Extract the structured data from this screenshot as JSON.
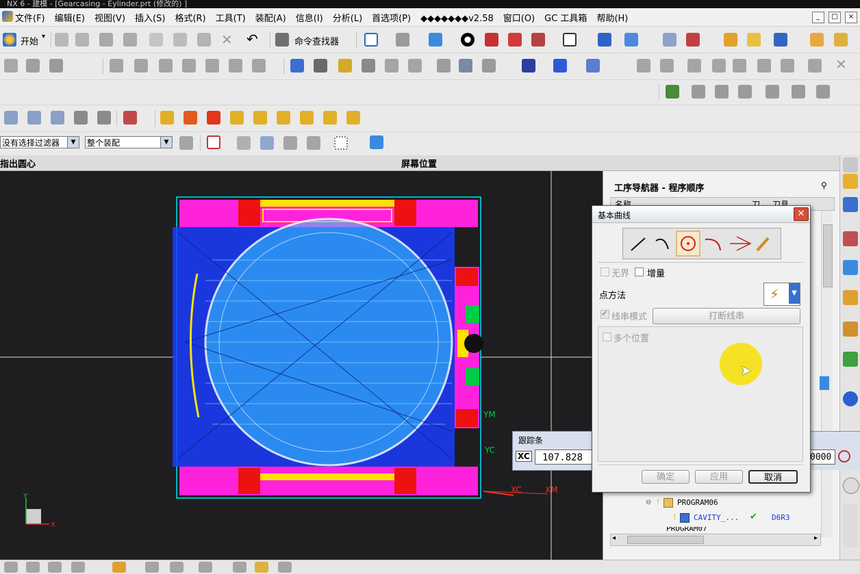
{
  "window": {
    "title": "NX 6 - 建模 - [Gearcasing - Eylinder.prt (修改的) ]",
    "buttons": [
      "_",
      "□",
      "×"
    ]
  },
  "menubar": {
    "items": [
      "文件(F)",
      "编辑(E)",
      "视图(V)",
      "插入(S)",
      "格式(R)",
      "工具(T)",
      "装配(A)",
      "信息(I)",
      "分析(L)",
      "首选项(P)",
      "◆◆◆◆◆◆◆v2.58",
      "窗口(O)",
      "GC 工具箱",
      "帮助(H)"
    ],
    "doc_buttons": [
      "_",
      "□",
      "×"
    ]
  },
  "toolbar": {
    "start_label": "开始",
    "command_finder_label": "命令查找器"
  },
  "filterbar": {
    "type_filter": "没有选择过滤器",
    "scope": "整个装配"
  },
  "cueline": {
    "prompt": "指出圆心",
    "status": "屏幕位置"
  },
  "viewport": {
    "axis_labels": {
      "ym": "YM",
      "xc": "XC",
      "xm": "XM",
      "yc": "YC",
      "triad_y": "Y",
      "triad_x": "X"
    }
  },
  "navigator": {
    "title": "工序导航器 - 程序顺序",
    "columns": [
      "名称",
      "刀",
      "刀具"
    ],
    "rows": [
      {
        "name": "PROGRAM06",
        "check": "",
        "tool": ""
      },
      {
        "name": "CAVITY_...",
        "check": "✔",
        "tool": "D6R3"
      },
      {
        "name": "PROGRAM07",
        "check": "",
        "tool": ""
      }
    ]
  },
  "dialog": {
    "title": "基本曲线",
    "infinite_label": "无界",
    "increment_label": "增量",
    "point_method_label": "点方法",
    "string_mode_label": "线串模式",
    "break_string_label": "打断线串",
    "multi_position_label": "多个位置",
    "ok_label": "确定",
    "apply_label": "应用",
    "cancel_label": "取消",
    "string_mode_checked": true
  },
  "trackbar": {
    "title": "跟踪条",
    "xc_label": "XC",
    "xc_value": "107.828",
    "right_value": "0000"
  },
  "colors": {
    "viewport_bg": "#1e1e20",
    "toolpath": "#1a3cff",
    "mold_magenta": "#ff22dd",
    "mold_red": "#ee1111",
    "dialog_title_gradient": "#dde2ea",
    "cursor_highlight": "#f7e21a"
  }
}
